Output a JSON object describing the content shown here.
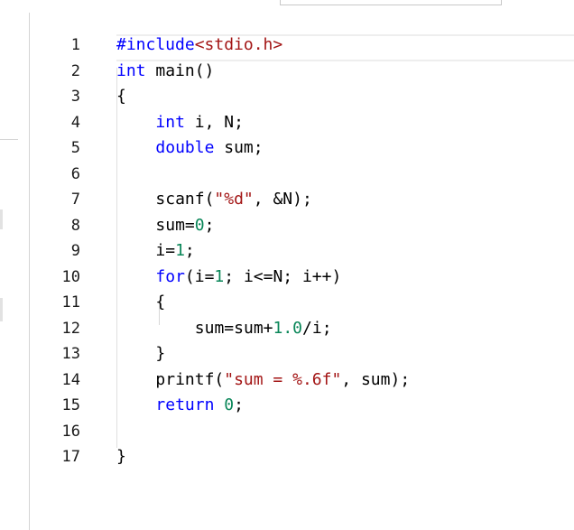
{
  "editor": {
    "lines": [
      {
        "n": "1",
        "indent": 0,
        "tokens": [
          {
            "t": "#include",
            "c": "kw"
          },
          {
            "t": "<stdio.h>",
            "c": "str"
          }
        ]
      },
      {
        "n": "2",
        "indent": 0,
        "tokens": [
          {
            "t": "int",
            "c": "kw"
          },
          {
            "t": " main()",
            "c": "plain"
          }
        ]
      },
      {
        "n": "3",
        "indent": 0,
        "tokens": [
          {
            "t": "{",
            "c": "plain"
          }
        ]
      },
      {
        "n": "4",
        "indent": 4,
        "tokens": [
          {
            "t": "int",
            "c": "kw"
          },
          {
            "t": " i, N;",
            "c": "plain"
          }
        ]
      },
      {
        "n": "5",
        "indent": 4,
        "tokens": [
          {
            "t": "double",
            "c": "kw"
          },
          {
            "t": " sum;",
            "c": "plain"
          }
        ]
      },
      {
        "n": "6",
        "indent": 0,
        "tokens": []
      },
      {
        "n": "7",
        "indent": 4,
        "tokens": [
          {
            "t": "scanf(",
            "c": "plain"
          },
          {
            "t": "\"%d\"",
            "c": "str"
          },
          {
            "t": ", &N);",
            "c": "plain"
          }
        ]
      },
      {
        "n": "8",
        "indent": 4,
        "tokens": [
          {
            "t": "sum=",
            "c": "plain"
          },
          {
            "t": "0",
            "c": "num"
          },
          {
            "t": ";",
            "c": "plain"
          }
        ]
      },
      {
        "n": "9",
        "indent": 4,
        "tokens": [
          {
            "t": "i=",
            "c": "plain"
          },
          {
            "t": "1",
            "c": "num"
          },
          {
            "t": ";",
            "c": "plain"
          }
        ]
      },
      {
        "n": "10",
        "indent": 4,
        "tokens": [
          {
            "t": "for",
            "c": "kw"
          },
          {
            "t": "(i=",
            "c": "plain"
          },
          {
            "t": "1",
            "c": "num"
          },
          {
            "t": "; i<=N; i++)",
            "c": "plain"
          }
        ]
      },
      {
        "n": "11",
        "indent": 4,
        "tokens": [
          {
            "t": "{",
            "c": "plain"
          }
        ]
      },
      {
        "n": "12",
        "indent": 8,
        "tokens": [
          {
            "t": "sum=sum+",
            "c": "plain"
          },
          {
            "t": "1.0",
            "c": "num"
          },
          {
            "t": "/i;",
            "c": "plain"
          }
        ]
      },
      {
        "n": "13",
        "indent": 4,
        "tokens": [
          {
            "t": "}",
            "c": "plain"
          }
        ]
      },
      {
        "n": "14",
        "indent": 4,
        "tokens": [
          {
            "t": "printf(",
            "c": "plain"
          },
          {
            "t": "\"sum = %.6f\"",
            "c": "str"
          },
          {
            "t": ", sum);",
            "c": "plain"
          }
        ]
      },
      {
        "n": "15",
        "indent": 4,
        "tokens": [
          {
            "t": "return",
            "c": "kw"
          },
          {
            "t": " ",
            "c": "plain"
          },
          {
            "t": "0",
            "c": "num"
          },
          {
            "t": ";",
            "c": "plain"
          }
        ]
      },
      {
        "n": "16",
        "indent": 0,
        "tokens": []
      },
      {
        "n": "17",
        "indent": 0,
        "tokens": [
          {
            "t": "}",
            "c": "plain"
          }
        ]
      }
    ]
  },
  "colors": {
    "keyword": "#0000ff",
    "string": "#a31515",
    "number": "#098658",
    "plain": "#000000",
    "line_number": "#1a1a1a"
  }
}
